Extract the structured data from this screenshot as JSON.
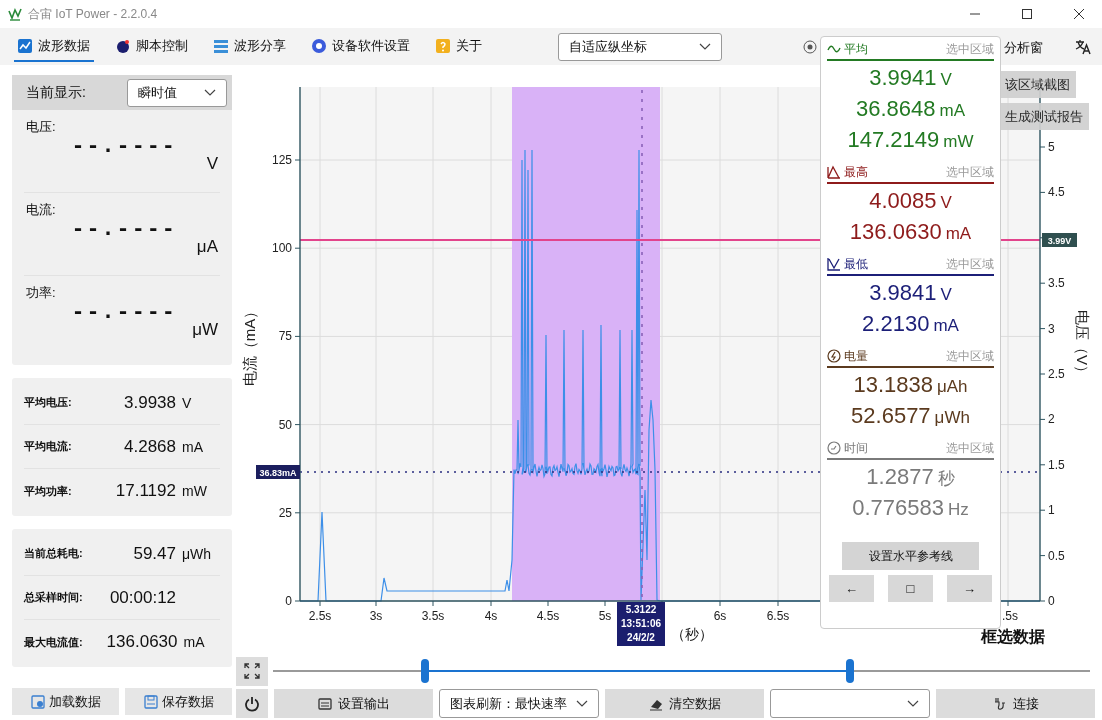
{
  "window": {
    "title": "合宙 IoT Power - 2.2.0.4"
  },
  "tabs": [
    {
      "label": "波形数据",
      "kind": "wave",
      "selected": true
    },
    {
      "label": "脚本控制",
      "kind": "script",
      "selected": false
    },
    {
      "label": "波形分享",
      "kind": "share",
      "selected": false
    },
    {
      "label": "设备软件设置",
      "kind": "settings",
      "selected": false
    },
    {
      "label": "关于",
      "kind": "about",
      "selected": false
    }
  ],
  "axis_mode": {
    "value": "自适应纵坐标"
  },
  "analysis_toggle": {
    "label": "分析窗"
  },
  "left_panel": {
    "display_label": "当前显示:",
    "display_value": "瞬时值",
    "readings": [
      {
        "label": "电压:",
        "value": "--.----",
        "unit": "V"
      },
      {
        "label": "电流:",
        "value": "--.----",
        "unit": "μA"
      },
      {
        "label": "功率:",
        "value": "--.----",
        "unit": "μW"
      }
    ],
    "averages": [
      {
        "label": "平均电压:",
        "value": "3.9938",
        "unit": "V"
      },
      {
        "label": "平均电流:",
        "value": "4.2868",
        "unit": "mA"
      },
      {
        "label": "平均功率:",
        "value": "17.1192",
        "unit": "mW"
      }
    ],
    "totals": [
      {
        "label": "当前总耗电:",
        "value": "59.47",
        "unit": "μWh"
      },
      {
        "label": "总采样时间:",
        "value": "00:00:12"
      },
      {
        "label": "最大电流值:",
        "value": "136.0630",
        "unit": "mA"
      }
    ],
    "buttons": [
      {
        "label": "加载数据",
        "kind": "load"
      },
      {
        "label": "保存数据",
        "kind": "save"
      }
    ]
  },
  "chart": {
    "y_left_title": "电流（mA）",
    "y_right_title": "电压（V）",
    "x_title": "（秒）",
    "y_left_ticks": [
      "125",
      "100",
      "75",
      "50",
      "25",
      "0"
    ],
    "y_right_ticks": [
      "5",
      "4.5",
      "3.5",
      "3",
      "2.5",
      "2",
      "1.5",
      "1",
      "0.5",
      "0"
    ],
    "x_ticks": [
      "2.5s",
      "3s",
      "3.5s",
      "4s",
      "4.5s",
      "5s",
      "6s",
      "6.5s"
    ],
    "x_tick_partial": ".5s",
    "current_marker": "36.83mA",
    "voltage_marker": "3.99V",
    "cursor": [
      "5.3122",
      "13:51:06",
      "24/2/2"
    ]
  },
  "chart_actions": [
    "该区域截图",
    "生成测试报告"
  ],
  "selection_caption": "框选数据",
  "float_panel": {
    "sections": [
      {
        "kind": "average",
        "title": "平均",
        "scope": "选中区域",
        "color": "#237a23",
        "values": [
          {
            "value": "3.9941",
            "unit": "V"
          },
          {
            "value": "36.8648",
            "unit": "mA"
          },
          {
            "value": "147.2149",
            "unit": "mW"
          }
        ]
      },
      {
        "kind": "max",
        "title": "最高",
        "scope": "选中区域",
        "color": "#8e1b1b",
        "values": [
          {
            "value": "4.0085",
            "unit": "V"
          },
          {
            "value": "136.0630",
            "unit": "mA"
          }
        ]
      },
      {
        "kind": "min",
        "title": "最低",
        "scope": "选中区域",
        "color": "#1c1f78",
        "values": [
          {
            "value": "3.9841",
            "unit": "V"
          },
          {
            "value": "2.2130",
            "unit": "mA"
          }
        ]
      },
      {
        "kind": "energy",
        "title": "电量",
        "scope": "选中区域",
        "color": "#5b3a1e",
        "values": [
          {
            "value": "13.1838",
            "unit": "μAh"
          },
          {
            "value": "52.6577",
            "unit": "μWh"
          }
        ]
      },
      {
        "kind": "time",
        "title": "时间",
        "scope": "选中区域",
        "color": "#7a7a7a",
        "values": [
          {
            "value": "1.2877",
            "unit": "秒"
          },
          {
            "value": "0.776583",
            "unit": "Hz"
          }
        ]
      }
    ],
    "reference_button": "设置水平参考线",
    "nav_buttons": [
      "←",
      "□",
      "→"
    ]
  },
  "timeline": {
    "handles": [
      {
        "level": 0.186
      },
      {
        "level": 0.706
      }
    ]
  },
  "bottom_bar": {
    "output_button": "设置输出",
    "refresh_select": "图表刷新：最快速率",
    "clear_button": "清空数据",
    "connect_button": "连接"
  }
}
